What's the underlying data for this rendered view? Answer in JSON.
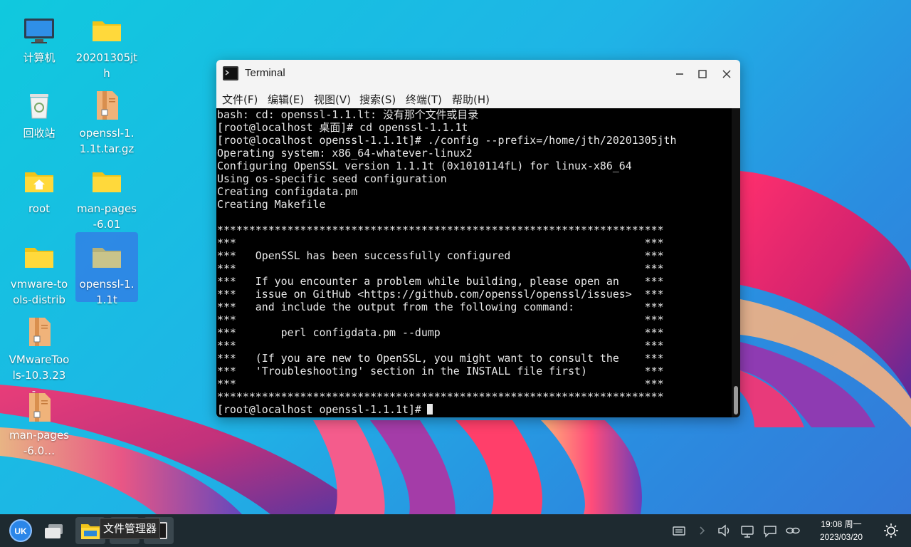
{
  "desktop_icons": [
    {
      "label": "计算机",
      "icon": "computer-icon"
    },
    {
      "label": "20201305jth",
      "icon": "folder-icon"
    },
    {
      "label": "回收站",
      "icon": "trash-icon"
    },
    {
      "label": "openssl-1.1.1t.tar.gz",
      "icon": "archive-icon"
    },
    {
      "label": "root",
      "icon": "home-folder-icon"
    },
    {
      "label": "man-pages-6.01",
      "icon": "folder-icon"
    },
    {
      "label": "vmware-tools-distrib",
      "icon": "folder-icon"
    },
    {
      "label": "openssl-1.1.1t",
      "icon": "folder-icon"
    },
    {
      "label": "VMwareTools-10.3.23-…",
      "icon": "archive-icon"
    },
    {
      "label": "man-pages-6.0…",
      "icon": "archive-icon"
    }
  ],
  "terminal": {
    "title": "Terminal",
    "menus": [
      "文件(F)",
      "编辑(E)",
      "视图(V)",
      "搜索(S)",
      "终端(T)",
      "帮助(H)"
    ],
    "lines": [
      "bash: cd: openssl-1.1.lt: 没有那个文件或目录",
      "[root@localhost 桌面]# cd openssl-1.1.1t",
      "[root@localhost openssl-1.1.1t]# ./config --prefix=/home/jth/20201305jth",
      "Operating system: x86_64-whatever-linux2",
      "Configuring OpenSSL version 1.1.1t (0x1010114fL) for linux-x86_64",
      "Using os-specific seed configuration",
      "Creating configdata.pm",
      "Creating Makefile",
      "",
      "**********************************************************************",
      "***                                                                ***",
      "***   OpenSSL has been successfully configured                     ***",
      "***                                                                ***",
      "***   If you encounter a problem while building, please open an    ***",
      "***   issue on GitHub <https://github.com/openssl/openssl/issues>  ***",
      "***   and include the output from the following command:           ***",
      "***                                                                ***",
      "***       perl configdata.pm --dump                                ***",
      "***                                                                ***",
      "***   (If you are new to OpenSSL, you might want to consult the    ***",
      "***   'Troubleshooting' section in the INSTALL file first)         ***",
      "***                                                                ***",
      "**********************************************************************"
    ],
    "prompt": "[root@localhost openssl-1.1.1t]#"
  },
  "taskbar": {
    "tooltip": "文件管理器",
    "time": "19:08 周一",
    "date": "2023/03/20",
    "start_icon": "kylin-start-icon",
    "accent": "#1e2a30"
  }
}
